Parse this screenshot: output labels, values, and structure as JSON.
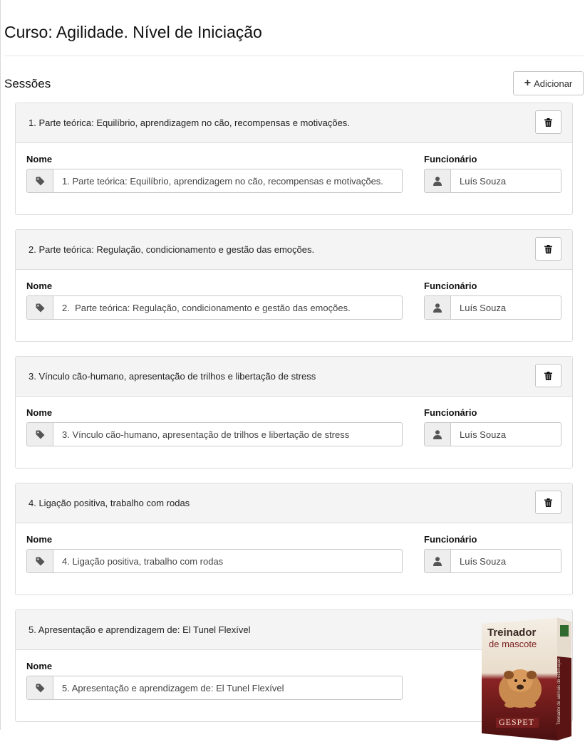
{
  "page": {
    "title": "Curso: Agilidade. Nível de Iniciação"
  },
  "sessions_section": {
    "title": "Sessões",
    "add_button_label": "Adicionar"
  },
  "labels": {
    "name": "Nome",
    "employee": "Funcionário"
  },
  "icons": {
    "add": "plus-icon",
    "delete": "trash-icon",
    "name_addon": "tag-icon",
    "employee_addon": "user-icon"
  },
  "sessions": [
    {
      "header": "1. Parte teórica: Equilíbrio, aprendizagem no cão, recompensas e motivações.",
      "name": "1. Parte teórica: Equilíbrio, aprendizagem no cão, recompensas e motivações.",
      "employee": "Luís Souza"
    },
    {
      "header": "2. Parte teórica: Regulação, condicionamento e gestão das emoções.",
      "name": "2.  Parte teórica: Regulação, condicionamento e gestão das emoções.",
      "employee": "Luís Souza"
    },
    {
      "header": "3. Vínculo cão-humano, apresentação de trilhos e libertação de stress",
      "name": "3. Vínculo cão-humano, apresentação de trilhos e libertação de stress",
      "employee": "Luís Souza"
    },
    {
      "header": "4. Ligação positiva, trabalho com rodas",
      "name": "4. Ligação positiva, trabalho com rodas",
      "employee": "Luís Souza"
    },
    {
      "header": "5. Apresentação e aprendizagem de: El Tunel Flexível",
      "name": "5. Apresentação e aprendizagem de: El Tunel Flexível",
      "employee": ""
    }
  ],
  "promo": {
    "title_line1": "Treinador",
    "title_line2": "de mascote",
    "brand": "GESPET",
    "side_text": "Treinador de animais de estimação",
    "colors": {
      "maroon": "#7a1f1f",
      "dark": "#3a0d0d",
      "cream": "#f1eadf"
    }
  }
}
